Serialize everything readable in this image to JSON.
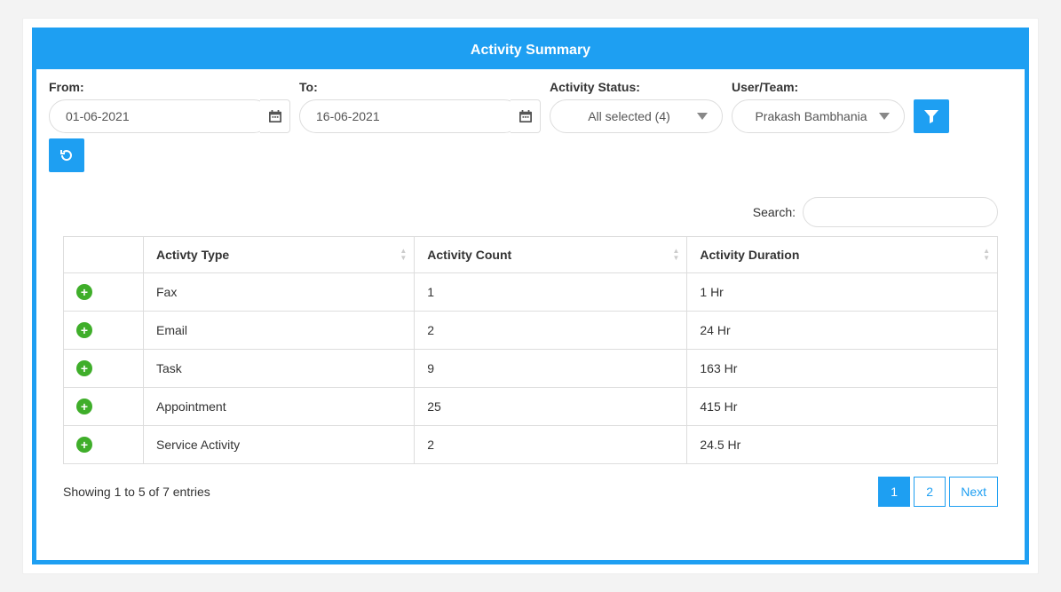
{
  "panel": {
    "title": "Activity Summary"
  },
  "filters": {
    "from": {
      "label": "From:",
      "value": "01-06-2021"
    },
    "to": {
      "label": "To:",
      "value": "16-06-2021"
    },
    "status": {
      "label": "Activity Status:",
      "selected": "All selected (4)"
    },
    "user": {
      "label": "User/Team:",
      "selected": "Prakash Bambhania"
    }
  },
  "search": {
    "label": "Search:",
    "value": ""
  },
  "table": {
    "columns": {
      "type": "Activty Type",
      "count": "Activity Count",
      "duration": "Activity Duration"
    },
    "rows": [
      {
        "type": "Fax",
        "count": "1",
        "duration": "1 Hr"
      },
      {
        "type": "Email",
        "count": "2",
        "duration": "24 Hr"
      },
      {
        "type": "Task",
        "count": "9",
        "duration": "163 Hr"
      },
      {
        "type": "Appointment",
        "count": "25",
        "duration": "415 Hr"
      },
      {
        "type": "Service Activity",
        "count": "2",
        "duration": "24.5 Hr"
      }
    ],
    "info": "Showing 1 to 5 of 7 entries"
  },
  "pager": {
    "page1": "1",
    "page2": "2",
    "next": "Next"
  }
}
